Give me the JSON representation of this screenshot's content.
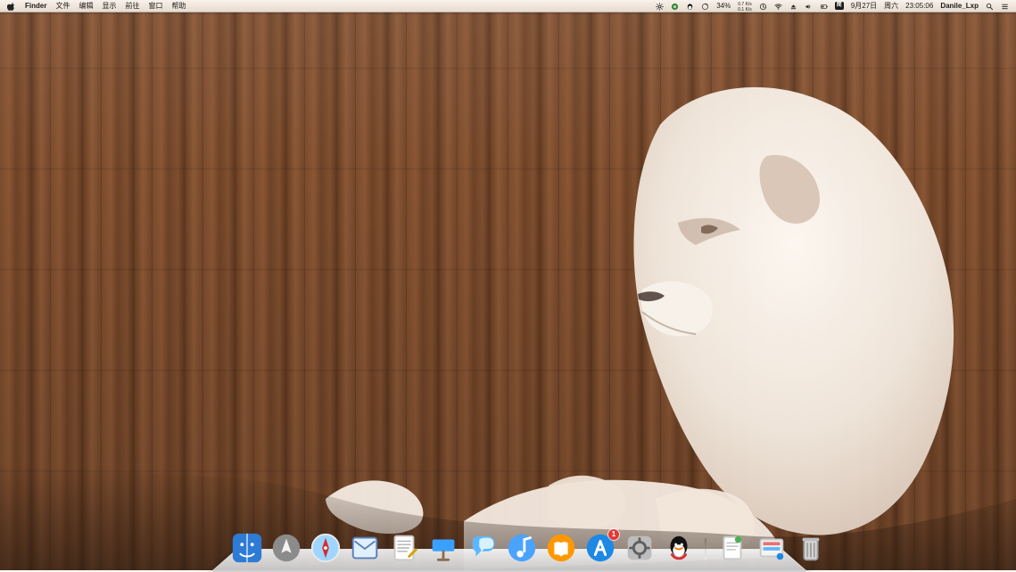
{
  "menubar": {
    "apple_icon": "apple-icon",
    "app_name": "Finder",
    "menus": [
      "文件",
      "编辑",
      "显示",
      "前往",
      "窗口",
      "帮助"
    ],
    "status": {
      "battery_percent": "34%",
      "net_up": "0.7 K/s",
      "net_down": "0.1 K/s",
      "date": "9月27日",
      "weekday": "周六",
      "time": "23:05:06",
      "user": "Danile_Lxp"
    }
  },
  "dock": {
    "app_store_badge": "1"
  }
}
